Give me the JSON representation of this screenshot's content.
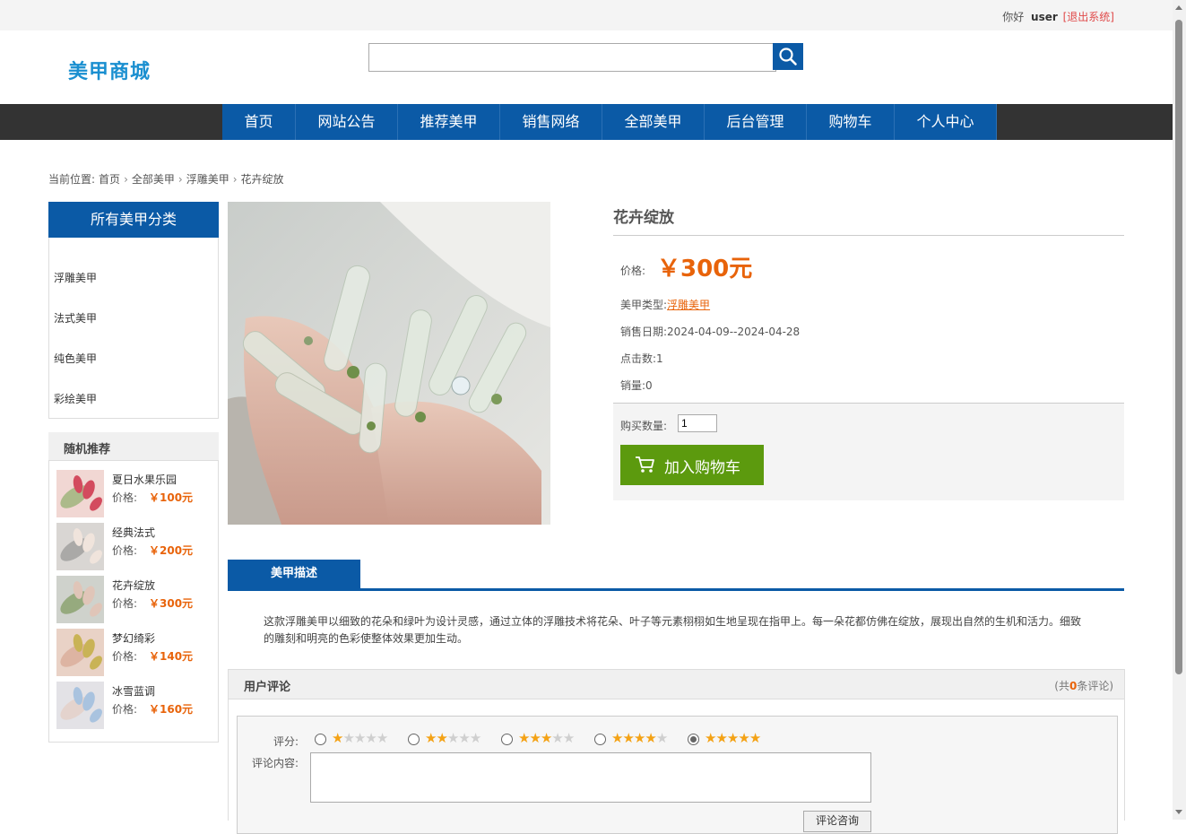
{
  "topbar": {
    "greeting": "你好",
    "username": "user",
    "logout": "[退出系统]"
  },
  "header": {
    "logo": "美甲商城",
    "search_value": ""
  },
  "nav": {
    "items": [
      "首页",
      "网站公告",
      "推荐美甲",
      "销售网络",
      "全部美甲",
      "后台管理",
      "购物车",
      "个人中心"
    ]
  },
  "breadcrumb": {
    "prefix": "当前位置:",
    "items": [
      "首页",
      "全部美甲",
      "浮雕美甲",
      "花卉绽放"
    ]
  },
  "sidebar": {
    "categories_title": "所有美甲分类",
    "categories": [
      "浮雕美甲",
      "法式美甲",
      "纯色美甲",
      "彩绘美甲"
    ],
    "random_title": "随机推荐",
    "price_label": "价格:",
    "random_items": [
      {
        "name": "夏日水果乐园",
        "price": "￥100元"
      },
      {
        "name": "经典法式",
        "price": "￥200元"
      },
      {
        "name": "花卉绽放",
        "price": "￥300元"
      },
      {
        "name": "梦幻绮彩",
        "price": "￥140元"
      },
      {
        "name": "冰雪蓝调",
        "price": "￥160元"
      }
    ]
  },
  "product": {
    "title": "花卉绽放",
    "price_label": "价格:",
    "price": "￥300元",
    "type_label": "美甲类型:",
    "type": "浮雕美甲",
    "date_label": "销售日期:",
    "date": "2024-04-09--2024-04-28",
    "clicks_label": "点击数:",
    "clicks": "1",
    "sales_label": "销量:",
    "sales": "0",
    "qty_label": "购买数量:",
    "qty": "1",
    "add_cart": "加入购物车"
  },
  "description": {
    "tab": "美甲描述",
    "text": "这款浮雕美甲以细致的花朵和绿叶为设计灵感，通过立体的浮雕技术将花朵、叶子等元素栩栩如生地呈现在指甲上。每一朵花都仿佛在绽放，展现出自然的生机和活力。细致的雕刻和明亮的色彩使整体效果更加生动。"
  },
  "reviews": {
    "title": "用户评论",
    "count_prefix": "(共",
    "count": "0",
    "count_suffix": "条评论)",
    "rating_label": "评分:",
    "content_label": "评论内容:",
    "rating_options": [
      1,
      2,
      3,
      4,
      5
    ],
    "selected_rating": 5,
    "submit": "评论咨询"
  },
  "colors": {
    "brand_blue": "#0b5aa6",
    "accent_orange": "#e8630a",
    "cart_green": "#5c9a0e",
    "logo_blue": "#1a8fd0"
  }
}
